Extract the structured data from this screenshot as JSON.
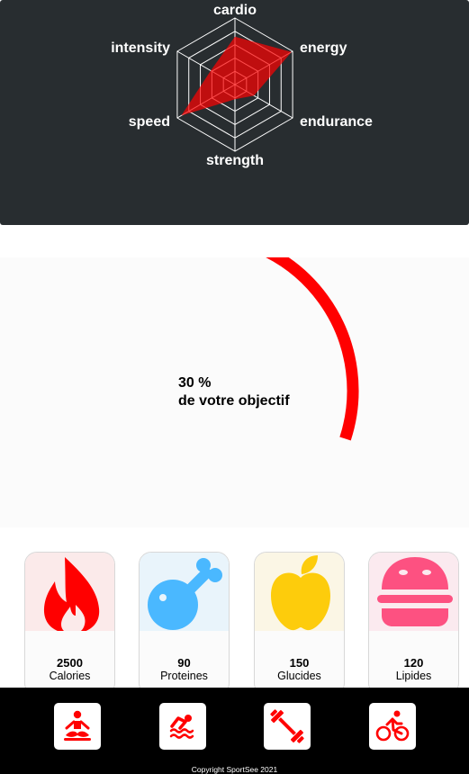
{
  "radar": {
    "axes": [
      "cardio",
      "energy",
      "endurance",
      "strength",
      "speed",
      "intensity"
    ],
    "values": [
      0.72,
      0.98,
      0.33,
      0.22,
      0.93,
      0.42
    ],
    "fill_color": "#ff0101",
    "grid_color": "#ffffff"
  },
  "score": {
    "percent_text": "30 %",
    "caption": "de votre objectif",
    "value_fraction": 0.3,
    "arc_color": "#ff0000"
  },
  "nutrition": [
    {
      "value": "2500",
      "label": "Calories",
      "icon": "flame-icon",
      "bg": "#fbeaea",
      "color": "#ff0000"
    },
    {
      "value": "90",
      "label": "Proteines",
      "icon": "chicken-leg-icon",
      "bg": "#e9f4fb",
      "color": "#4ab8ff"
    },
    {
      "value": "150",
      "label": "Glucides",
      "icon": "apple-icon",
      "bg": "#fbf6e5",
      "color": "#fdcc0c"
    },
    {
      "value": "120",
      "label": "Lipides",
      "icon": "burger-icon",
      "bg": "#fbeaef",
      "color": "#fd5181"
    }
  ],
  "footer": {
    "activities": [
      "yoga-icon",
      "swimming-icon",
      "dumbbell-icon",
      "cycling-icon"
    ],
    "icon_color": "#ff0101",
    "copyright": "Copyright SportSee 2021"
  }
}
